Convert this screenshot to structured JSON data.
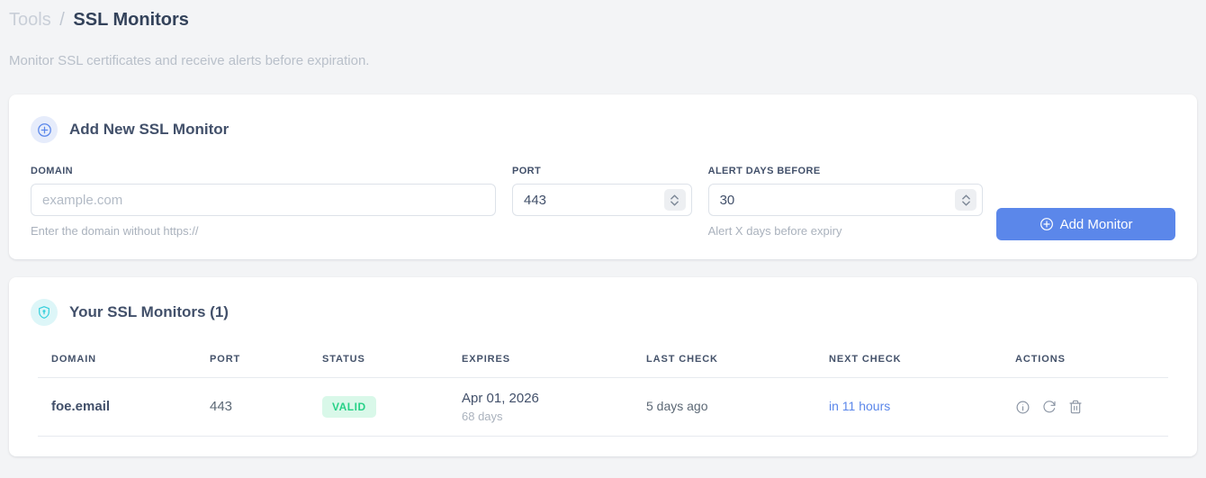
{
  "page": {
    "breadcrumb": {
      "section": "Tools",
      "separator": "/",
      "current": "SSL Monitors"
    },
    "subtitle": "Monitor SSL certificates and receive alerts before expiration."
  },
  "add_form": {
    "title": "Add New SSL Monitor",
    "fields": {
      "domain": {
        "label": "DOMAIN",
        "placeholder": "example.com",
        "value": "",
        "helper": "Enter the domain without https://"
      },
      "port": {
        "label": "PORT",
        "value": "443"
      },
      "alert_days": {
        "label": "ALERT DAYS BEFORE",
        "value": "30",
        "helper": "Alert X days before expiry"
      }
    },
    "submit_label": "Add Monitor"
  },
  "monitors": {
    "title": "Your SSL Monitors (1)",
    "count": "1",
    "table": {
      "headers": [
        "DOMAIN",
        "PORT",
        "STATUS",
        "EXPIRES",
        "LAST CHECK",
        "NEXT CHECK",
        "ACTIONS"
      ],
      "rows": [
        {
          "domain": "foe.email",
          "port": "443",
          "status": "VALID",
          "expires_date": "Apr 01, 2026",
          "expires_in": "68 days",
          "last_check": "5 days ago",
          "next_check": "in 11 hours"
        }
      ]
    }
  },
  "icons": {
    "add_badge": "plus-circle",
    "list_badge": "shield",
    "row_actions": [
      "info",
      "refresh",
      "trash"
    ]
  },
  "colors": {
    "accent_blue": "#5b87ea",
    "badge_blue_bg": "#e6ecfb",
    "shield_cyan": "#33cfdc",
    "shield_bg": "#ddf6f8",
    "valid_text": "#27d187",
    "valid_bg": "#d9f8e9",
    "page_bg": "#f3f4f6"
  }
}
